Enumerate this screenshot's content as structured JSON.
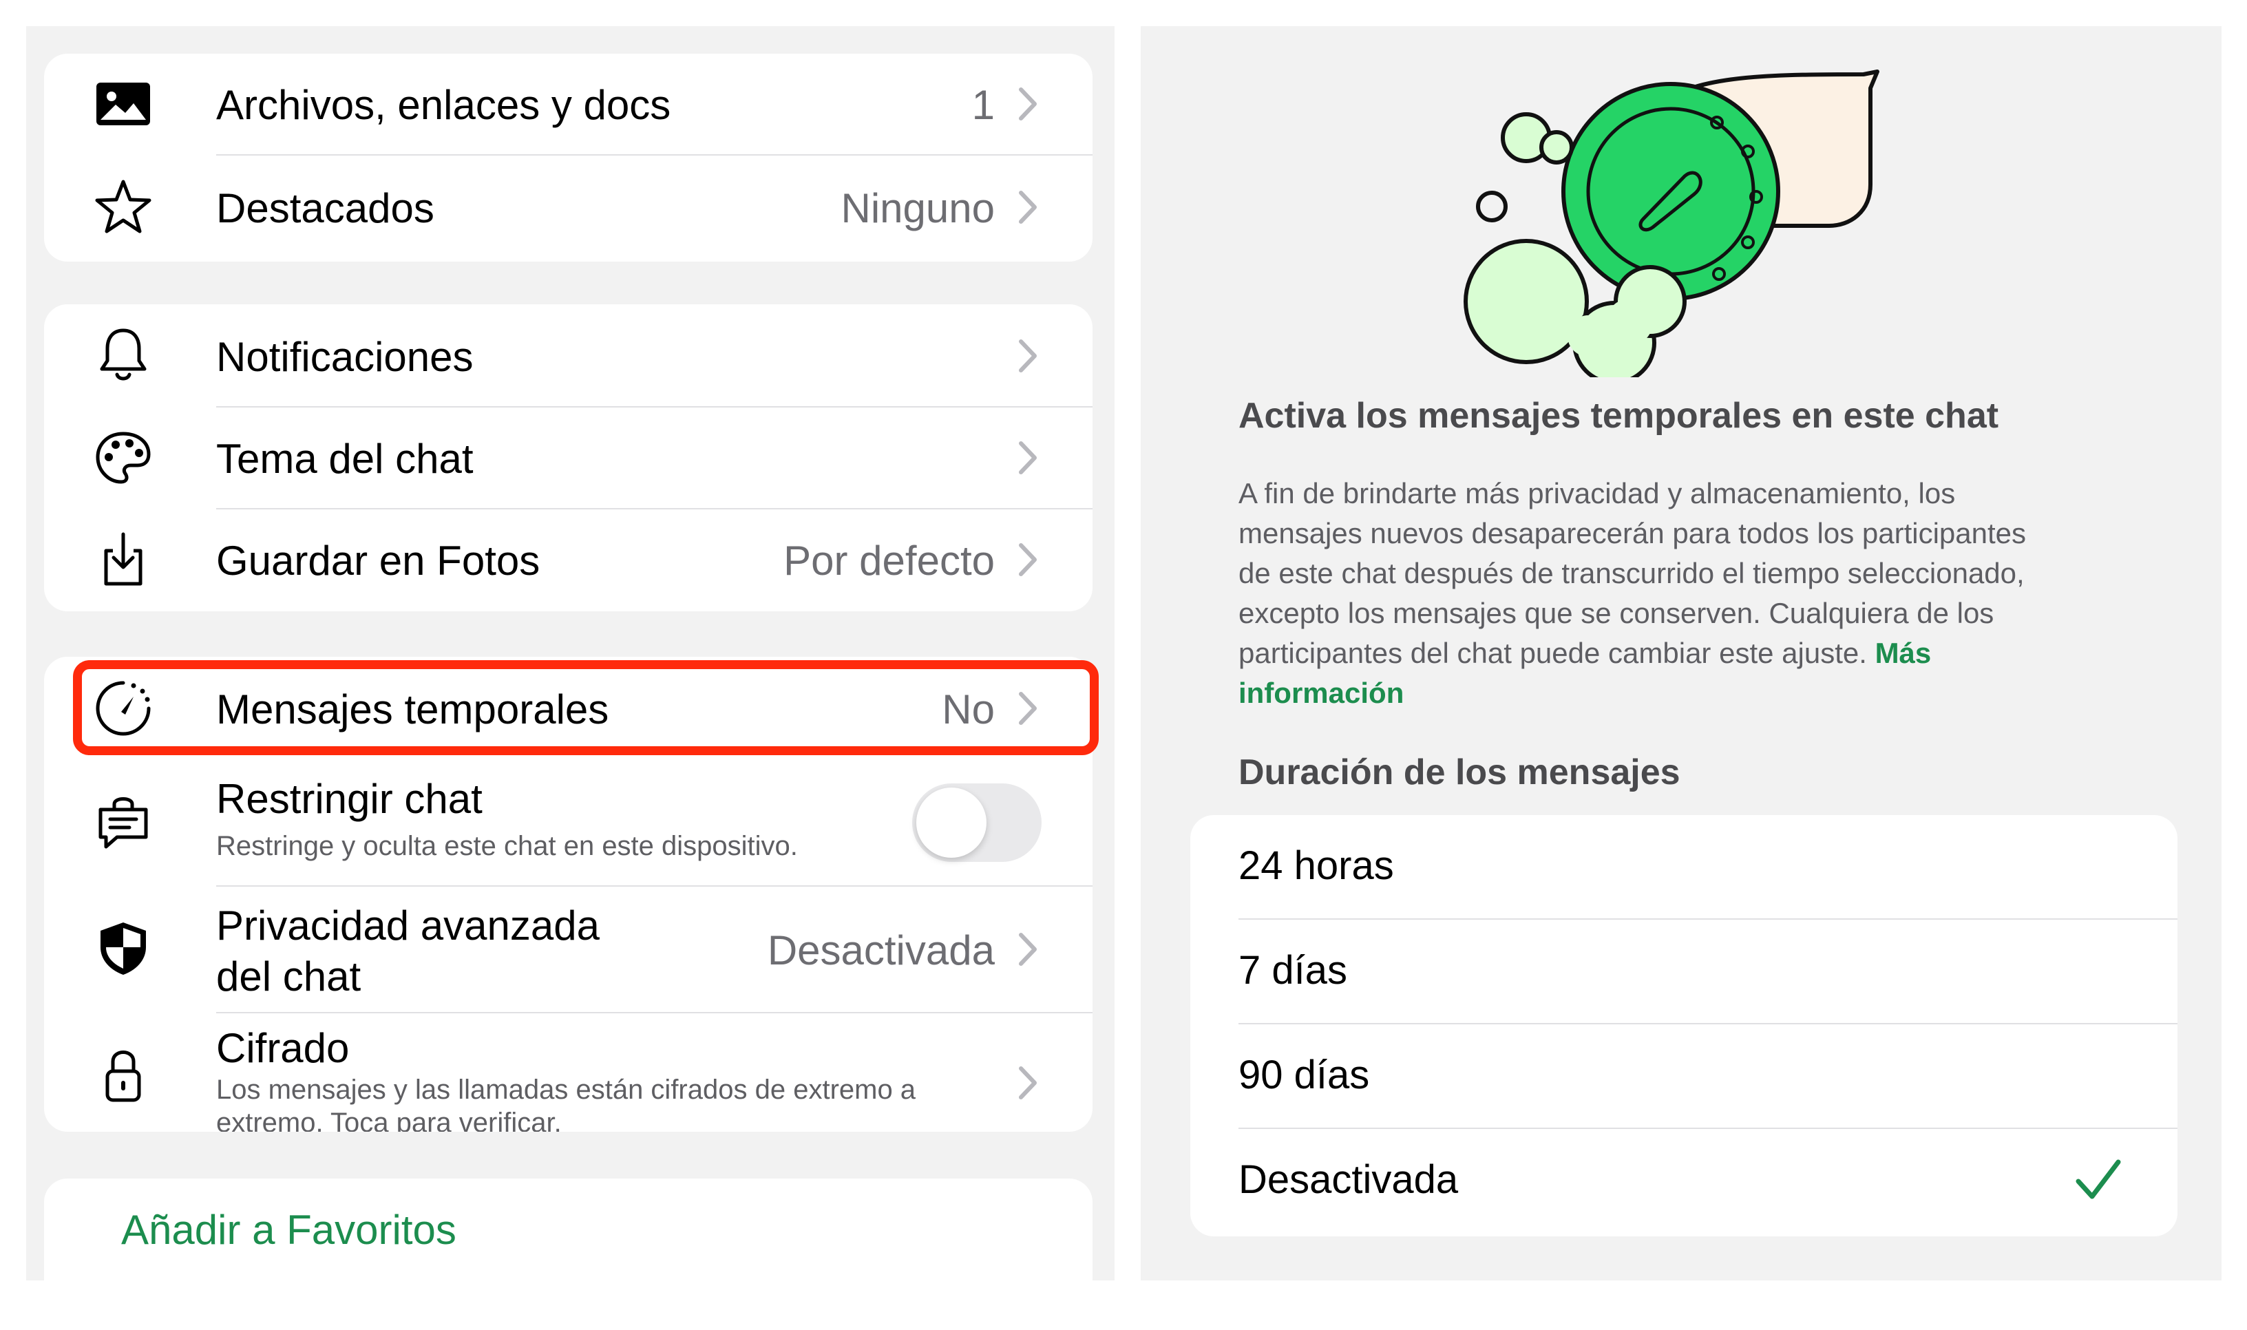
{
  "left": {
    "group1": [
      {
        "id": "media",
        "icon": "photo-icon",
        "label": "Archivos, enlaces y docs",
        "value": "1"
      },
      {
        "id": "starred",
        "icon": "star-icon",
        "label": "Destacados",
        "value": "Ninguno"
      }
    ],
    "group2": [
      {
        "id": "notifications",
        "icon": "bell-icon",
        "label": "Notificaciones",
        "value": ""
      },
      {
        "id": "theme",
        "icon": "palette-icon",
        "label": "Tema del chat",
        "value": ""
      },
      {
        "id": "save-photos",
        "icon": "download-icon",
        "label": "Guardar en Fotos",
        "value": "Por defecto"
      }
    ],
    "group3": {
      "disappearing": {
        "icon": "timer-icon",
        "label": "Mensajes temporales",
        "value": "No"
      },
      "restrict": {
        "icon": "locked-chat-icon",
        "label": "Restringir chat",
        "sub": "Restringe y oculta este chat en este dispositivo.",
        "toggle_on": false
      },
      "advanced_privacy": {
        "icon": "shield-icon",
        "label_line1": "Privacidad avanzada",
        "label_line2": "del chat",
        "value": "Desactivada"
      },
      "encryption": {
        "icon": "lock-icon",
        "label": "Cifrado",
        "sub_line1": "Los mensajes y las llamadas están cifrados de extremo a",
        "sub_line2": "extremo. Toca para verificar."
      }
    },
    "add_favorites": "Añadir a Favoritos"
  },
  "right": {
    "title": "Activa los mensajes temporales en este chat",
    "description_lines": [
      "A fin de brindarte más privacidad y almacenamiento, los",
      "mensajes nuevos desaparecerán para todos los participantes",
      "de este chat después de transcurrido el tiempo seleccionado,",
      "excepto los mensajes que se conserven. Cualquiera de los",
      "participantes del chat puede cambiar este ajuste."
    ],
    "link_part1": "Más",
    "link_part2": "información",
    "duration_header": "Duración de los mensajes",
    "options": [
      "24 horas",
      "7 días",
      "90 días",
      "Desactivada"
    ],
    "selected_option": "Desactivada"
  },
  "colors": {
    "accent_green": "#1c8d4e",
    "highlight_red": "#ff2a0c",
    "illustration_green": "#25d366",
    "illustration_light_green": "#d9fdd3"
  }
}
